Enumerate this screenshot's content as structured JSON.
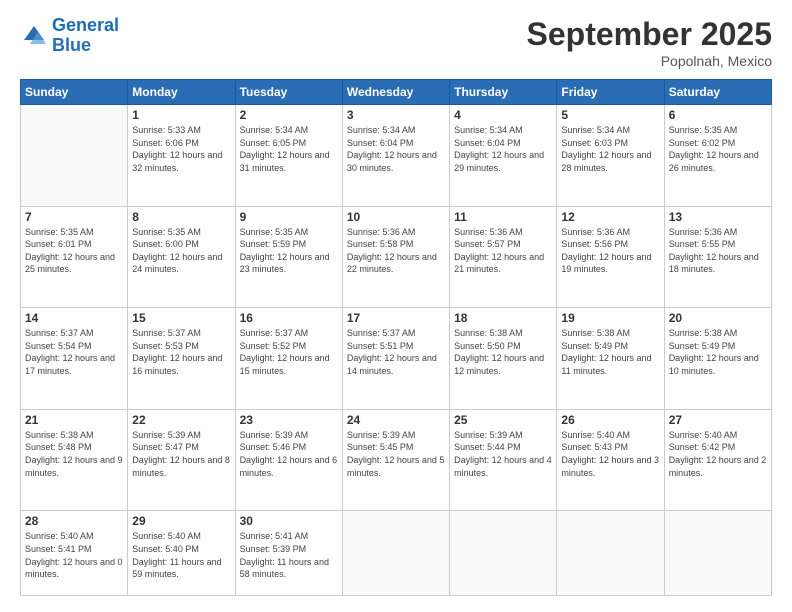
{
  "logo": {
    "line1": "General",
    "line2": "Blue"
  },
  "header": {
    "month": "September 2025",
    "location": "Popolnah, Mexico"
  },
  "weekdays": [
    "Sunday",
    "Monday",
    "Tuesday",
    "Wednesday",
    "Thursday",
    "Friday",
    "Saturday"
  ],
  "weeks": [
    [
      {
        "day": "",
        "info": ""
      },
      {
        "day": "1",
        "info": "Sunrise: 5:33 AM\nSunset: 6:06 PM\nDaylight: 12 hours\nand 32 minutes."
      },
      {
        "day": "2",
        "info": "Sunrise: 5:34 AM\nSunset: 6:05 PM\nDaylight: 12 hours\nand 31 minutes."
      },
      {
        "day": "3",
        "info": "Sunrise: 5:34 AM\nSunset: 6:04 PM\nDaylight: 12 hours\nand 30 minutes."
      },
      {
        "day": "4",
        "info": "Sunrise: 5:34 AM\nSunset: 6:04 PM\nDaylight: 12 hours\nand 29 minutes."
      },
      {
        "day": "5",
        "info": "Sunrise: 5:34 AM\nSunset: 6:03 PM\nDaylight: 12 hours\nand 28 minutes."
      },
      {
        "day": "6",
        "info": "Sunrise: 5:35 AM\nSunset: 6:02 PM\nDaylight: 12 hours\nand 26 minutes."
      }
    ],
    [
      {
        "day": "7",
        "info": "Sunrise: 5:35 AM\nSunset: 6:01 PM\nDaylight: 12 hours\nand 25 minutes."
      },
      {
        "day": "8",
        "info": "Sunrise: 5:35 AM\nSunset: 6:00 PM\nDaylight: 12 hours\nand 24 minutes."
      },
      {
        "day": "9",
        "info": "Sunrise: 5:35 AM\nSunset: 5:59 PM\nDaylight: 12 hours\nand 23 minutes."
      },
      {
        "day": "10",
        "info": "Sunrise: 5:36 AM\nSunset: 5:58 PM\nDaylight: 12 hours\nand 22 minutes."
      },
      {
        "day": "11",
        "info": "Sunrise: 5:36 AM\nSunset: 5:57 PM\nDaylight: 12 hours\nand 21 minutes."
      },
      {
        "day": "12",
        "info": "Sunrise: 5:36 AM\nSunset: 5:56 PM\nDaylight: 12 hours\nand 19 minutes."
      },
      {
        "day": "13",
        "info": "Sunrise: 5:36 AM\nSunset: 5:55 PM\nDaylight: 12 hours\nand 18 minutes."
      }
    ],
    [
      {
        "day": "14",
        "info": "Sunrise: 5:37 AM\nSunset: 5:54 PM\nDaylight: 12 hours\nand 17 minutes."
      },
      {
        "day": "15",
        "info": "Sunrise: 5:37 AM\nSunset: 5:53 PM\nDaylight: 12 hours\nand 16 minutes."
      },
      {
        "day": "16",
        "info": "Sunrise: 5:37 AM\nSunset: 5:52 PM\nDaylight: 12 hours\nand 15 minutes."
      },
      {
        "day": "17",
        "info": "Sunrise: 5:37 AM\nSunset: 5:51 PM\nDaylight: 12 hours\nand 14 minutes."
      },
      {
        "day": "18",
        "info": "Sunrise: 5:38 AM\nSunset: 5:50 PM\nDaylight: 12 hours\nand 12 minutes."
      },
      {
        "day": "19",
        "info": "Sunrise: 5:38 AM\nSunset: 5:49 PM\nDaylight: 12 hours\nand 11 minutes."
      },
      {
        "day": "20",
        "info": "Sunrise: 5:38 AM\nSunset: 5:49 PM\nDaylight: 12 hours\nand 10 minutes."
      }
    ],
    [
      {
        "day": "21",
        "info": "Sunrise: 5:38 AM\nSunset: 5:48 PM\nDaylight: 12 hours\nand 9 minutes."
      },
      {
        "day": "22",
        "info": "Sunrise: 5:39 AM\nSunset: 5:47 PM\nDaylight: 12 hours\nand 8 minutes."
      },
      {
        "day": "23",
        "info": "Sunrise: 5:39 AM\nSunset: 5:46 PM\nDaylight: 12 hours\nand 6 minutes."
      },
      {
        "day": "24",
        "info": "Sunrise: 5:39 AM\nSunset: 5:45 PM\nDaylight: 12 hours\nand 5 minutes."
      },
      {
        "day": "25",
        "info": "Sunrise: 5:39 AM\nSunset: 5:44 PM\nDaylight: 12 hours\nand 4 minutes."
      },
      {
        "day": "26",
        "info": "Sunrise: 5:40 AM\nSunset: 5:43 PM\nDaylight: 12 hours\nand 3 minutes."
      },
      {
        "day": "27",
        "info": "Sunrise: 5:40 AM\nSunset: 5:42 PM\nDaylight: 12 hours\nand 2 minutes."
      }
    ],
    [
      {
        "day": "28",
        "info": "Sunrise: 5:40 AM\nSunset: 5:41 PM\nDaylight: 12 hours\nand 0 minutes."
      },
      {
        "day": "29",
        "info": "Sunrise: 5:40 AM\nSunset: 5:40 PM\nDaylight: 11 hours\nand 59 minutes."
      },
      {
        "day": "30",
        "info": "Sunrise: 5:41 AM\nSunset: 5:39 PM\nDaylight: 11 hours\nand 58 minutes."
      },
      {
        "day": "",
        "info": ""
      },
      {
        "day": "",
        "info": ""
      },
      {
        "day": "",
        "info": ""
      },
      {
        "day": "",
        "info": ""
      }
    ]
  ]
}
